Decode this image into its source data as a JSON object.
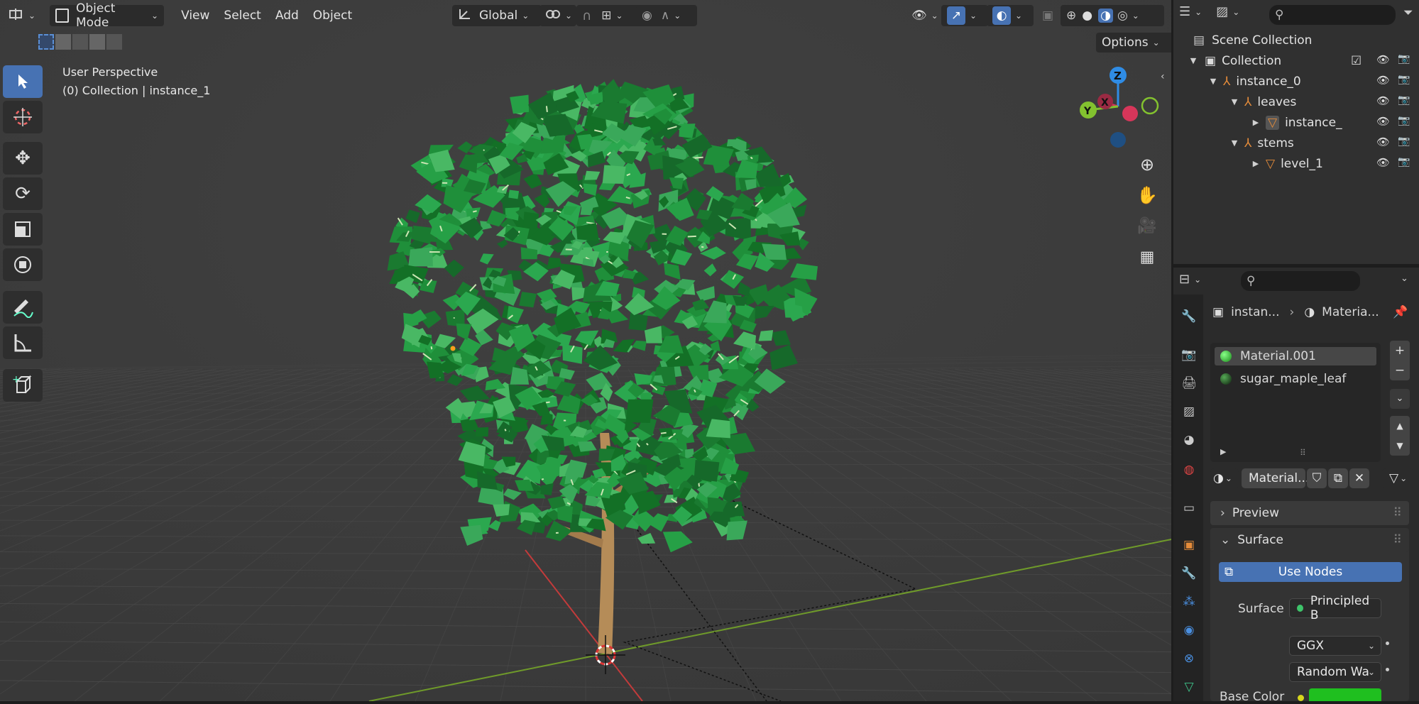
{
  "header": {
    "mode": "Object Mode",
    "menus": [
      "View",
      "Select",
      "Add",
      "Object"
    ],
    "transform_orientation": "Global",
    "options_label": "Options"
  },
  "viewport": {
    "perspective_label": "User Perspective",
    "collection_label": "(0) Collection | instance_1",
    "gizmo_axes": {
      "z": "Z",
      "x": "X",
      "y": "Y"
    }
  },
  "outliner": {
    "rows": [
      {
        "label": "Scene Collection"
      },
      {
        "label": "Collection"
      },
      {
        "label": "instance_0"
      },
      {
        "label": "leaves"
      },
      {
        "label": "instance_"
      },
      {
        "label": "stems"
      },
      {
        "label": "level_1"
      }
    ]
  },
  "properties": {
    "breadcrumb_object": "instan...",
    "breadcrumb_material": "Materia...",
    "material_slots": [
      "Material.001",
      "sugar_maple_leaf"
    ],
    "material_name": "Material...",
    "panels": {
      "preview": "Preview",
      "surface": "Surface"
    },
    "use_nodes_label": "Use Nodes",
    "surface_label": "Surface",
    "surface_value": "Principled B",
    "distribution": "GGX",
    "subsurface_method": "Random Wa",
    "base_color_label": "Base Color"
  },
  "colors": {
    "accent": "#4772b3",
    "leaf_green": "#1f8f3a",
    "base_color": "#1fbf1f"
  }
}
